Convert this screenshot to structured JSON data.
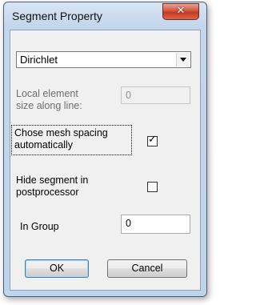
{
  "window": {
    "title": "Segment Property",
    "close_icon": "close-icon"
  },
  "boundary_type": {
    "selected": "Dirichlet"
  },
  "local_element_size": {
    "label_line1": "Local element",
    "label_line2": "size along line:",
    "value": "0",
    "enabled": false
  },
  "auto_mesh_spacing": {
    "label_line1": "Chose mesh spacing",
    "label_line2": "automatically",
    "checked": true
  },
  "hide_segment": {
    "label_line1": "Hide segment in",
    "label_line2": "postprocessor",
    "checked": false
  },
  "group": {
    "label": "In Group",
    "value": "0"
  },
  "buttons": {
    "ok": "OK",
    "cancel": "Cancel"
  }
}
